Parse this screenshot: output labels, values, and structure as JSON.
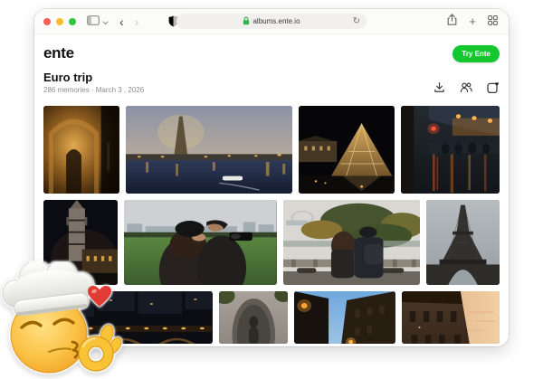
{
  "browser": {
    "url": "albums.ente.io",
    "glyphs": {
      "back": "‹",
      "forward": "›",
      "reload": "↻",
      "new_tab": "+"
    },
    "icons": [
      "traffic-close",
      "traffic-minimize",
      "traffic-zoom",
      "sidebar-toggle-icon",
      "privacy-shield-icon",
      "lock-icon",
      "reload-icon",
      "share-icon",
      "new-tab-icon",
      "tab-overview-icon"
    ],
    "lock_color": "#2fb74b",
    "traffic_colors": [
      "#ff5f57",
      "#febc2e",
      "#28c840"
    ]
  },
  "site": {
    "logo": "ente",
    "try_button_label": "Try Ente",
    "accent_green": "#14c72e"
  },
  "album": {
    "title": "Euro trip",
    "subtitle": "286 memories · March 3 , 2026",
    "action_icons": [
      "download-icon",
      "people-icon",
      "save-heart-icon"
    ]
  },
  "photos": {
    "row1": [
      {
        "label": "Arc de Triomphe at night"
      },
      {
        "label": "Eiffel Tower over the Seine at dusk"
      },
      {
        "label": "Louvre Pyramid at night"
      },
      {
        "label": "Rainy cafe street at night"
      }
    ],
    "row2": [
      {
        "label": "Gothic tower at night"
      },
      {
        "label": "Couple taking photos in a park"
      },
      {
        "label": "Couple overlooking park with ferris wheel"
      },
      {
        "label": "Eiffel Tower from below"
      }
    ],
    "row3": [
      {
        "label": "City bridge lights at night"
      },
      {
        "label": "Manneken Pis statue"
      },
      {
        "label": "Old street at dusk"
      },
      {
        "label": "Louvre facade at sunset"
      }
    ]
  },
  "sticker": {
    "name": "chefs-kiss emoji with chef hat and heart"
  }
}
